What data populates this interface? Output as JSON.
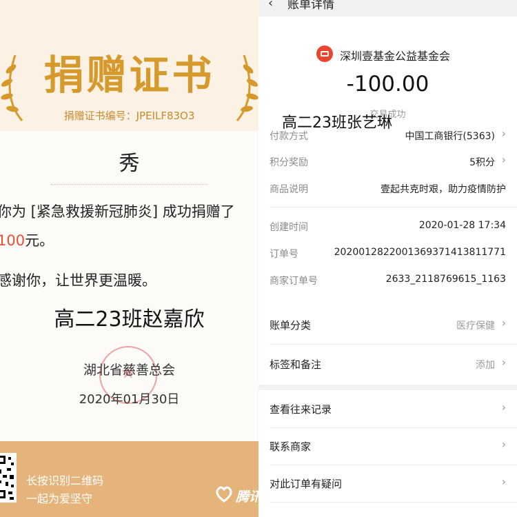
{
  "certificate": {
    "title": "捐赠证书",
    "number_label": "捐赠证书编号：",
    "number_value": "JPEILF83O3",
    "donor_name": "秀",
    "body_line1": "你为 [紧急救援新冠肺炎] 成功捐赠了",
    "amount": "100",
    "currency": "元。",
    "thanks": "感谢你，让世界更温暖。",
    "handwritten": "高二23班赵嘉欣",
    "org": "湖北省慈善总会",
    "date": "2020年01月30日",
    "footer_line1": "长按识别二维码",
    "footer_line2": "一起为爱坚守",
    "footer_brand": "腾讯"
  },
  "bill": {
    "header_title": "账单详情",
    "merchant": "深圳壹基金公益基金会",
    "amount": "-100.00",
    "status": "交易成功",
    "overlay_name": "高二23班张艺琳",
    "rows": [
      {
        "label": "付款方式",
        "value": "中国工商银行(5363)",
        "chevron": true
      },
      {
        "label": "积分奖励",
        "value": "5积分",
        "chevron": true
      },
      {
        "label": "商品说明",
        "value": "壹起共克时艰，助力疫情防护",
        "chevron": false
      },
      {
        "label": "创建时间",
        "value": "2020-01-28 17:34",
        "chevron": false
      },
      {
        "label": "订单号",
        "value": "2020012822001369371413811771",
        "chevron": false
      },
      {
        "label": "商家订单号",
        "value": "2633_2118769615_1163",
        "chevron": false
      }
    ],
    "category": {
      "label": "账单分类",
      "value": "医疗保健"
    },
    "tags": {
      "label": "标签和备注",
      "value": "添加"
    },
    "menu": [
      {
        "label": "查看往来记录"
      },
      {
        "label": "联系商家"
      },
      {
        "label": "对此订单有疑问"
      }
    ]
  },
  "colors": {
    "title_gold": "#d69a2c",
    "footer_tan": "#e5b47b",
    "amount_red": "#e94c37",
    "merchant_red": "#e8462f"
  }
}
